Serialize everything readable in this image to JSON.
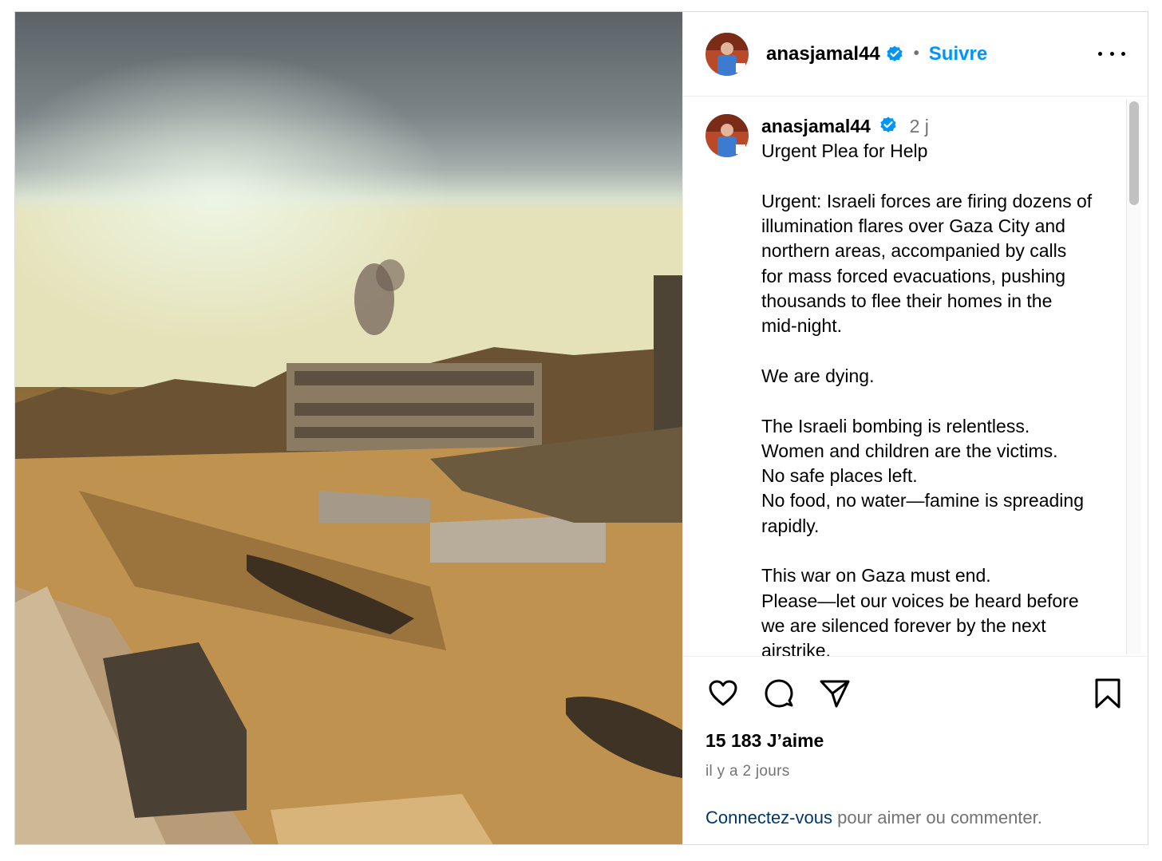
{
  "header": {
    "username": "anasjamal44",
    "separator": "•",
    "follow_label": "Suivre",
    "avatar_icon": "profile-avatar",
    "verified_icon": "verified-badge-icon",
    "more_icon": "more-options-icon"
  },
  "caption": {
    "username": "anasjamal44",
    "time": "2 j",
    "lines": [
      "Urgent Plea for Help",
      "",
      "Urgent: Israeli forces are firing dozens of",
      "illumination flares over Gaza City and",
      "northern areas, accompanied by calls",
      "for mass forced evacuations, pushing",
      "thousands to flee their homes in the",
      "mid-night.",
      "",
      "We are dying.",
      "",
      "The Israeli bombing is relentless.",
      "Women and children are the victims.",
      "No safe places left.",
      "No food, no water—famine is spreading",
      "rapidly.",
      "",
      "This war on Gaza must end.",
      "Please—let our voices be heard before",
      "we are silenced forever by the next",
      "airstrike."
    ]
  },
  "actions": {
    "like_icon": "heart-icon",
    "comment_icon": "comment-icon",
    "share_icon": "share-icon",
    "save_icon": "bookmark-icon"
  },
  "likes_text": "15 183 J’aime",
  "date_text": "il y a 2 jours",
  "login": {
    "link_text": "Connectez-vous",
    "rest_text": " pour aimer ou commenter."
  },
  "colors": {
    "accent": "#0095f6",
    "link": "#00376b",
    "muted": "#737373",
    "verified": "#0095f6"
  }
}
